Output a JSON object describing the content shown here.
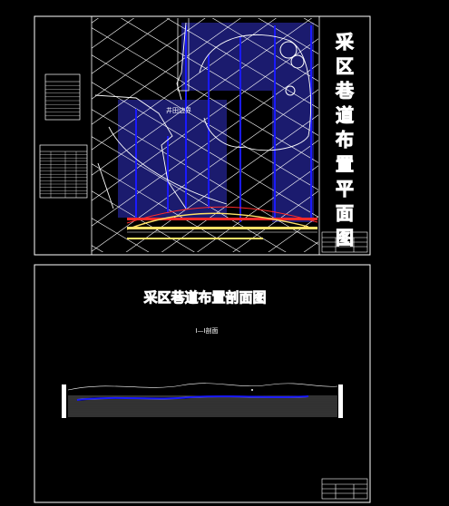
{
  "sheet1": {
    "title": "采区巷道布置平面图",
    "area_label": "井田边界",
    "left_tables": [
      {
        "rows": 10
      },
      {
        "rows": 14
      }
    ]
  },
  "sheet2": {
    "title": "采区巷道布置剖面图",
    "section_label": "I—I剖面"
  },
  "colors": {
    "background": "#000000",
    "line": "#ffffff",
    "seam": "#1a1aff",
    "fill": "#1e1e7a",
    "red": "#ff2a2a",
    "yellow": "#ffe066"
  }
}
